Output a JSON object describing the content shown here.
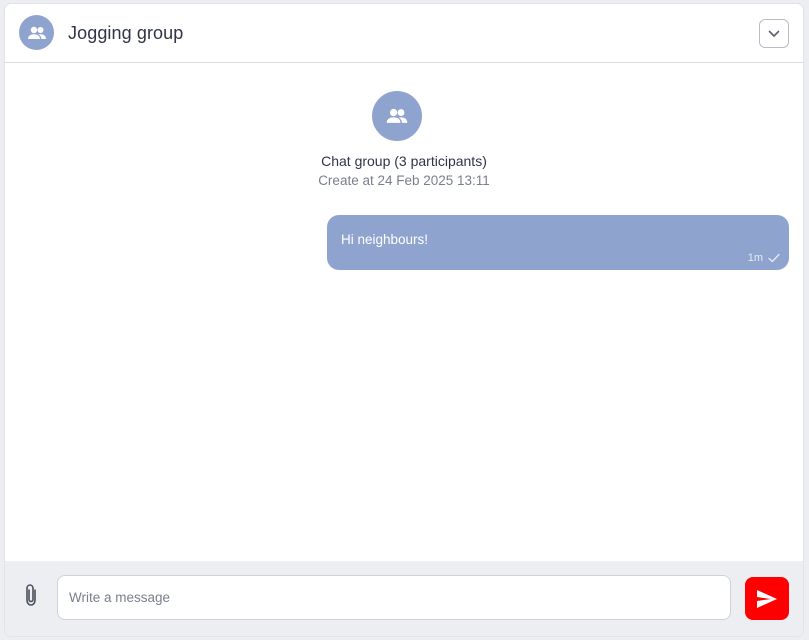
{
  "header": {
    "title": "Jogging group",
    "avatar_icon": "group-icon",
    "collapse_icon": "chevron-down-icon"
  },
  "group_info": {
    "icon": "group-icon",
    "title": "Chat group (3 participants)",
    "created": "Create at 24 Feb 2025 13:11"
  },
  "messages": [
    {
      "text": "Hi neighbours!",
      "time": "1m",
      "status_icon": "check-icon"
    }
  ],
  "composer": {
    "attach_icon": "paperclip-icon",
    "placeholder": "Write a message",
    "value": "",
    "send_icon": "send-icon"
  },
  "colors": {
    "accent": "#8fa3cf",
    "send_button": "#fe0000",
    "footer_bg": "#eceef2"
  }
}
